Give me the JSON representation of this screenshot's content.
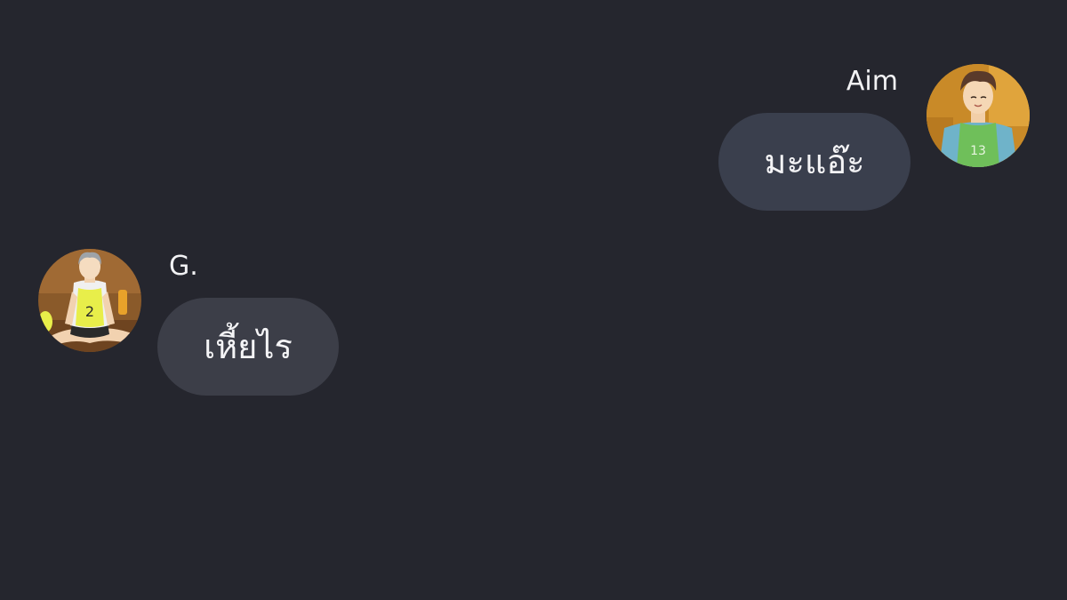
{
  "messages": [
    {
      "side": "right",
      "sender": "Aim",
      "text": "มะแอ๊ะ",
      "avatar_icon": "avatar-aim",
      "bubble_color": "#3a3f4d"
    },
    {
      "side": "left",
      "sender": "G.",
      "text": "เหี้ยไร",
      "avatar_icon": "avatar-g",
      "bubble_color": "#3c3e48"
    }
  ],
  "colors": {
    "background": "#25262e",
    "text": "#f4f4f6"
  },
  "avatars": {
    "aim_jersey_number": "13",
    "g_jersey_number": "2"
  }
}
